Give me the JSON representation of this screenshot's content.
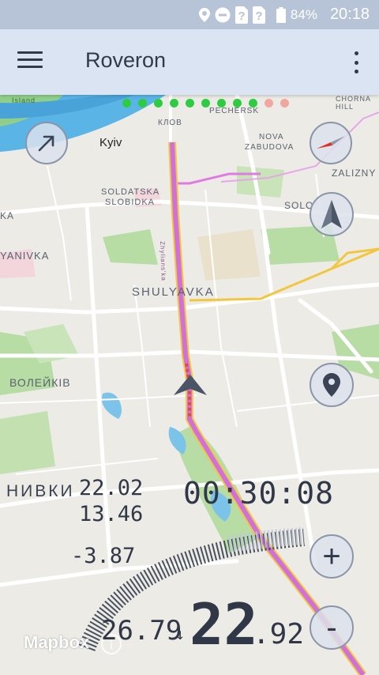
{
  "status_bar": {
    "icons": [
      "location-pin-icon",
      "do-not-disturb-icon",
      "unknown-sim-icon",
      "unknown-sim-icon",
      "battery-icon"
    ],
    "battery": "84%",
    "time": "20:18"
  },
  "app_bar": {
    "title": "Roveron",
    "menu_icon": "hamburger-menu-icon",
    "overflow_icon": "more-vertical-icon"
  },
  "map": {
    "place_labels": {
      "island": "Island",
      "kyiv": "Kyiv",
      "klov": "КЛОВ",
      "pechersk": "PECHERSK",
      "chorna_hill_1": "CHORNA",
      "chorna_hill_2": "HILL",
      "nova_zabudova_1": "NOVA",
      "nova_zabudova_2": "ZABUDOVA",
      "zaliznychnyi": "ZALIZNY",
      "soldatska_1": "SOLDATSKA",
      "soldatska_2": "SLOBIDKA",
      "solomianka": "SOLO",
      "ka": "KA",
      "yanivka": "YANIVKA",
      "shuliavka": "SHULYAVKA",
      "voleikiv": "ВОЛЕЙКІВ",
      "nyvky": "НИВКИ",
      "street": "Zhylians'ka"
    },
    "attribution": "Mapbox",
    "route_color": "#d070d8",
    "progress_dots": [
      "#2ecc40",
      "#2ecc40",
      "#2ecc40",
      "#2ecc40",
      "#2ecc40",
      "#2ecc40",
      "#2ecc40",
      "#2ecc40",
      "#2ecc40",
      "#f2a6a0",
      "#f2a6a0"
    ]
  },
  "controls": {
    "direction_icon": "arrow-northeast-icon",
    "compass_icon": "compass-icon",
    "navigate_icon": "navigation-arrow-icon",
    "location_icon": "location-pin-icon",
    "zoom_in_label": "+",
    "zoom_out_label": "-"
  },
  "telemetry": {
    "value_top": "22.02",
    "value_mid": "13.46",
    "value_delta": "-3.87",
    "elapsed_time": "00:30:08",
    "avg_speed": "26.79",
    "avg_arrow": "↓",
    "speed_int": "22",
    "speed_dec": ".92"
  }
}
